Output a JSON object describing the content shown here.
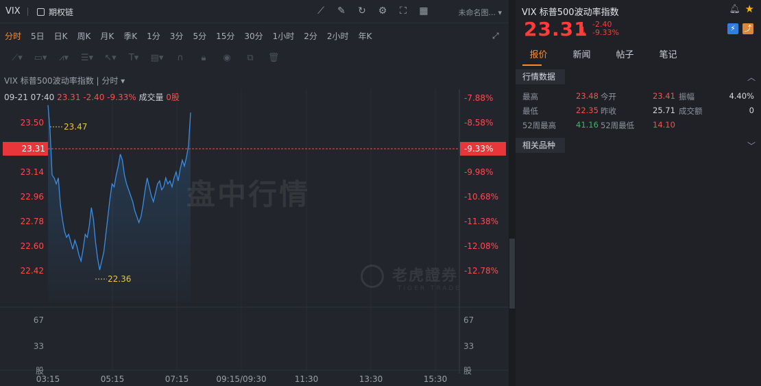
{
  "toolbar": {
    "symbol": "VIX",
    "options_chain": "期权链",
    "template": "未命名图..."
  },
  "periods": [
    "分时",
    "5日",
    "日K",
    "周K",
    "月K",
    "季K",
    "1分",
    "3分",
    "5分",
    "15分",
    "30分",
    "1小时",
    "2分",
    "2小时",
    "年K"
  ],
  "active_period": "分时",
  "chart_header": "VIX 标普500波动率指数 | 分时 ▾",
  "info": {
    "time": "09-21 07:40",
    "price": "23.31",
    "change": "-2.40",
    "pct": "-9.33%",
    "vol_label": "成交量",
    "vol": "0股"
  },
  "watermark": "盘中行情",
  "logo": {
    "cn": "老虎證券",
    "en": "TIGER TRADE"
  },
  "chart_data": {
    "type": "line",
    "title": "",
    "x_ticks": [
      "03:15",
      "05:15",
      "07:15",
      "09:15/09:30",
      "11:30",
      "13:30",
      "15:30"
    ],
    "y_left_ticks": [
      "23.50",
      "23.14",
      "22.96",
      "22.78",
      "22.60",
      "22.42"
    ],
    "y_right_ticks": [
      "-7.88%",
      "-8.58%",
      "-9.98%",
      "-10.68%",
      "-11.38%",
      "-12.08%",
      "-12.78%"
    ],
    "current_price_label": "23.31",
    "current_pct_label": "-9.33%",
    "high_label": "23.47",
    "low_label": "22.36",
    "ylim": [
      22.35,
      23.55
    ],
    "volume_ticks": [
      "67",
      "33",
      "股"
    ],
    "volume_unit_right": "股",
    "series": [
      {
        "values": [
          23.47,
          23.3,
          23.0,
          22.98,
          22.94,
          22.98,
          22.8,
          22.7,
          22.62,
          22.58,
          22.6,
          22.55,
          22.5,
          22.56,
          22.52,
          22.46,
          22.42,
          22.5,
          22.6,
          22.58,
          22.66,
          22.78,
          22.7,
          22.55,
          22.44,
          22.36,
          22.42,
          22.48,
          22.6,
          22.72,
          22.84,
          22.94,
          22.92,
          23.0,
          23.06,
          23.14,
          23.1,
          23.0,
          22.94,
          22.9,
          22.86,
          22.82,
          22.76,
          22.72,
          22.68,
          22.72,
          22.8,
          22.9,
          22.98,
          22.92,
          22.86,
          22.82,
          22.88,
          22.94,
          22.96,
          22.9,
          22.92,
          22.98,
          22.94,
          22.96,
          22.92,
          22.98,
          23.02,
          22.96,
          23.04,
          23.1,
          23.06,
          23.12,
          23.2,
          23.42
        ]
      }
    ]
  },
  "quote": {
    "title": "VIX 标普500波动率指数",
    "price": "23.31",
    "arrow": "↓",
    "change": "-2.40",
    "pct": "-9.33%",
    "tabs": [
      "报价",
      "新闻",
      "帖子",
      "笔记"
    ],
    "section_data": "行情数据",
    "section_related": "相关品种",
    "fields": [
      {
        "label": "最高",
        "value": "23.48",
        "color": "red"
      },
      {
        "label": "今开",
        "value": "23.41",
        "color": "red"
      },
      {
        "label": "振幅",
        "value": "4.40%",
        "color": "white"
      },
      {
        "label": "最低",
        "value": "22.35",
        "color": "red"
      },
      {
        "label": "昨收",
        "value": "25.71",
        "color": "white"
      },
      {
        "label": "成交额",
        "value": "0",
        "color": "white"
      },
      {
        "label": "52周最高",
        "value": "41.16",
        "color": "green"
      },
      {
        "label": "52周最低",
        "value": "14.10",
        "color": "red"
      }
    ]
  },
  "colors": {
    "accent": "#ff8a2a",
    "down": "#ff3b3b",
    "up": "#2fbf5f",
    "line": "#3a8ee6"
  }
}
